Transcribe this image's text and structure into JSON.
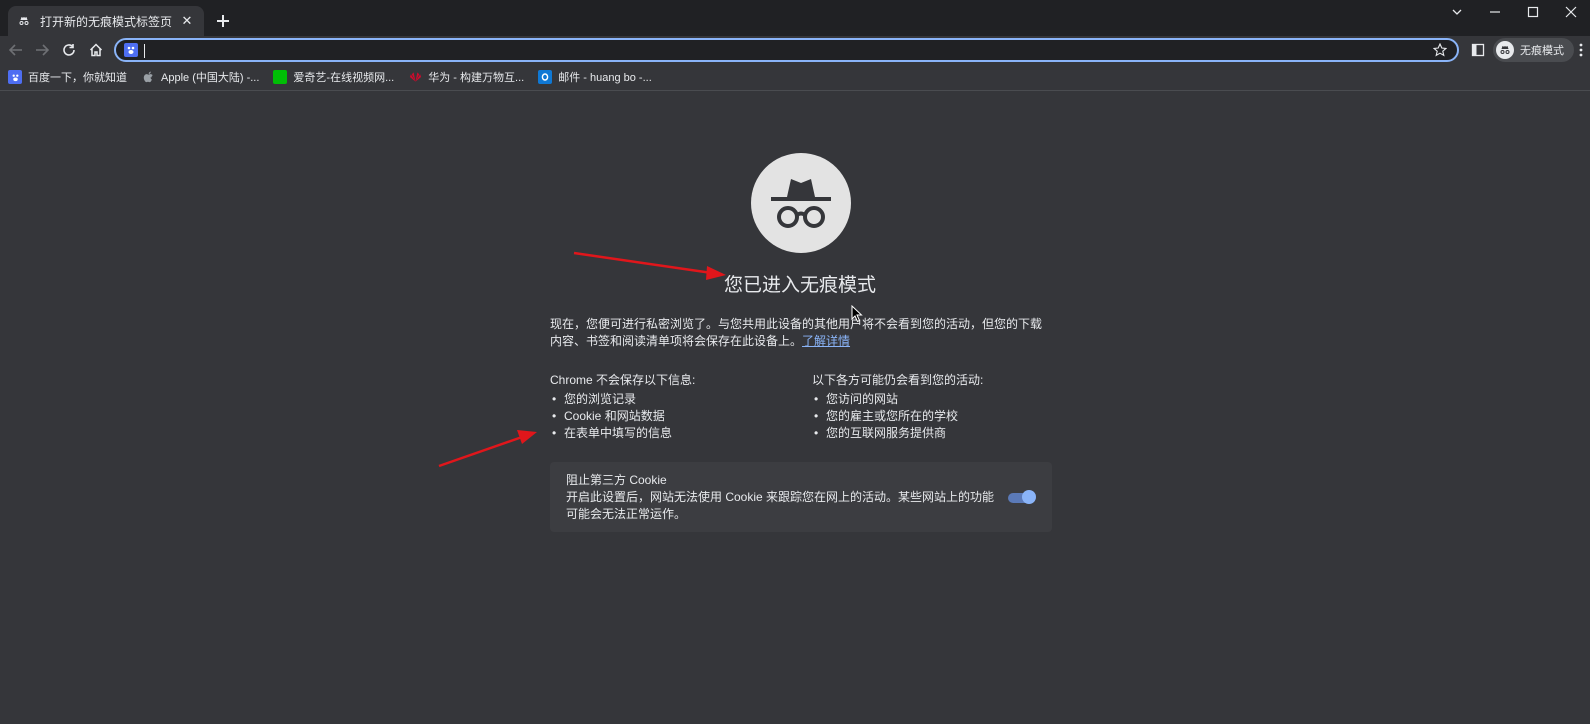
{
  "tab": {
    "title": "打开新的无痕模式标签页",
    "close": "✕"
  },
  "new_tab_label": "+",
  "omnibox": {
    "value": "",
    "placeholder": ""
  },
  "profile": {
    "label": "无痕模式"
  },
  "bookmarks": [
    {
      "label": "百度一下，你就知道",
      "icon": "baidu-icon",
      "color": "#4e6ef2"
    },
    {
      "label": "Apple (中国大陆) -...",
      "icon": "apple-icon",
      "color": "#9aa0a6"
    },
    {
      "label": "爱奇艺-在线视频网...",
      "icon": "iqiyi-icon",
      "color": "#00be06"
    },
    {
      "label": "华为 - 构建万物互...",
      "icon": "huawei-icon",
      "color": "#cf0a2c"
    },
    {
      "label": "邮件 - huang bo -...",
      "icon": "outlook-icon",
      "color": "#0f78d4"
    }
  ],
  "main": {
    "heading": "您已进入无痕模式",
    "intro": "现在，您便可进行私密浏览了。与您共用此设备的其他用户将不会看到您的活动，但您的下载内容、书签和阅读清单项将会保存在此设备上。",
    "learn_more": "了解详情",
    "not_saved": {
      "title": "Chrome 不会保存以下信息:",
      "items": [
        "您的浏览记录",
        "Cookie 和网站数据",
        "在表单中填写的信息"
      ]
    },
    "may_see": {
      "title": "以下各方可能仍会看到您的活动:",
      "items": [
        "您访问的网站",
        "您的雇主或您所在的学校",
        "您的互联网服务提供商"
      ]
    },
    "cookie": {
      "title": "阻止第三方 Cookie",
      "desc": "开启此设置后，网站无法使用 Cookie 来跟踪您在网上的活动。某些网站上的功能可能会无法正常运作。",
      "enabled": true
    }
  },
  "colors": {
    "page_bg": "#35363a",
    "tabbar_bg": "#202124",
    "accent": "#8ab4f8",
    "annotation_arrow": "#e0161b"
  }
}
